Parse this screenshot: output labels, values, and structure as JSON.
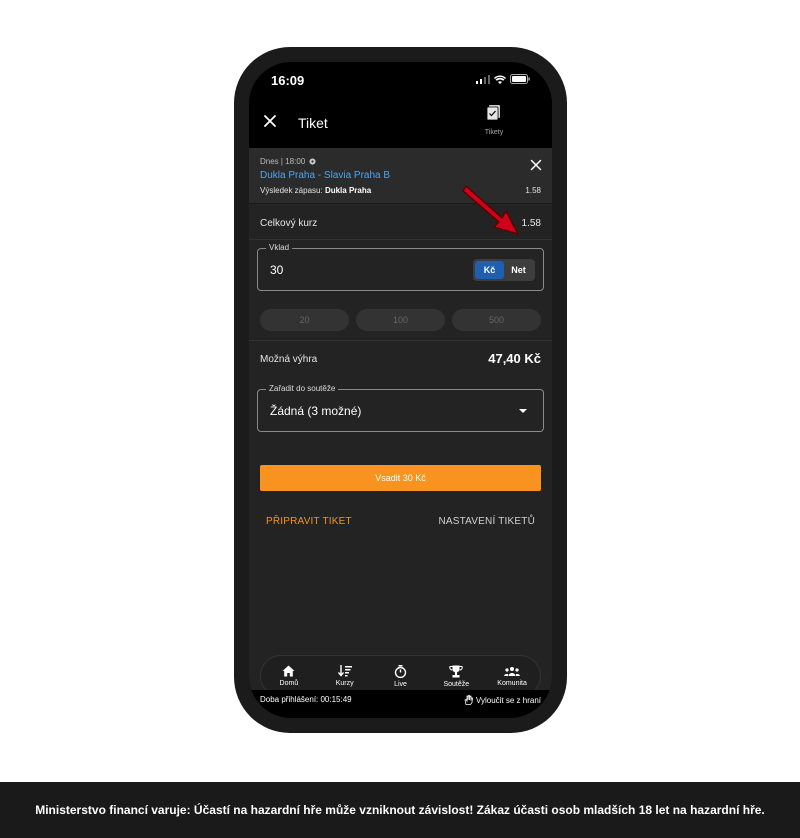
{
  "status_bar": {
    "time": "16:09"
  },
  "header": {
    "title": "Tiket",
    "tickets_label": "Tikety"
  },
  "bet": {
    "meta": "Dnes | 18:00",
    "match": "Dukla Praha - Slavia Praha B",
    "market_label": "Výsledek zápasu:",
    "selection": "Dukla Praha",
    "odds": "1.58"
  },
  "total": {
    "label": "Celkový kurz",
    "value": "1.58"
  },
  "stake": {
    "legend": "Vklad",
    "value": "30",
    "currencies": [
      "Kč",
      "Net"
    ],
    "active_currency": "Kč"
  },
  "quick_amounts": [
    "20",
    "100",
    "500"
  ],
  "possible_win": {
    "label": "Možná výhra",
    "value": "47,40 Kč"
  },
  "competition": {
    "legend": "Zařadit do soutěže",
    "value": "Žádná (3 možné)"
  },
  "place_bet_label": "Vsadit 30 Kč",
  "actions": {
    "prepare": "PŘIPRAVIT TIKET",
    "settings": "NASTAVENÍ TIKETŮ"
  },
  "nav": [
    {
      "label": "Domů",
      "icon": "home-icon"
    },
    {
      "label": "Kurzy",
      "icon": "sort-icon"
    },
    {
      "label": "Live",
      "icon": "stopwatch-icon"
    },
    {
      "label": "Soutěže",
      "icon": "trophy-icon"
    },
    {
      "label": "Komunita",
      "icon": "community-icon"
    }
  ],
  "session": {
    "label": "Doba přihlášení: 00:15:49",
    "exclude": "Vyloučit se z hraní"
  },
  "warning": "Ministerstvo financí varuje: Účastí na hazardní hře může vzniknout závislost! Zákaz účasti osob mladších 18 let na hazardní hře.",
  "colors": {
    "accent": "#f7931e",
    "link": "#4fa3f0",
    "toggle_active": "#1f5fb0",
    "arrow": "#d0021b"
  }
}
